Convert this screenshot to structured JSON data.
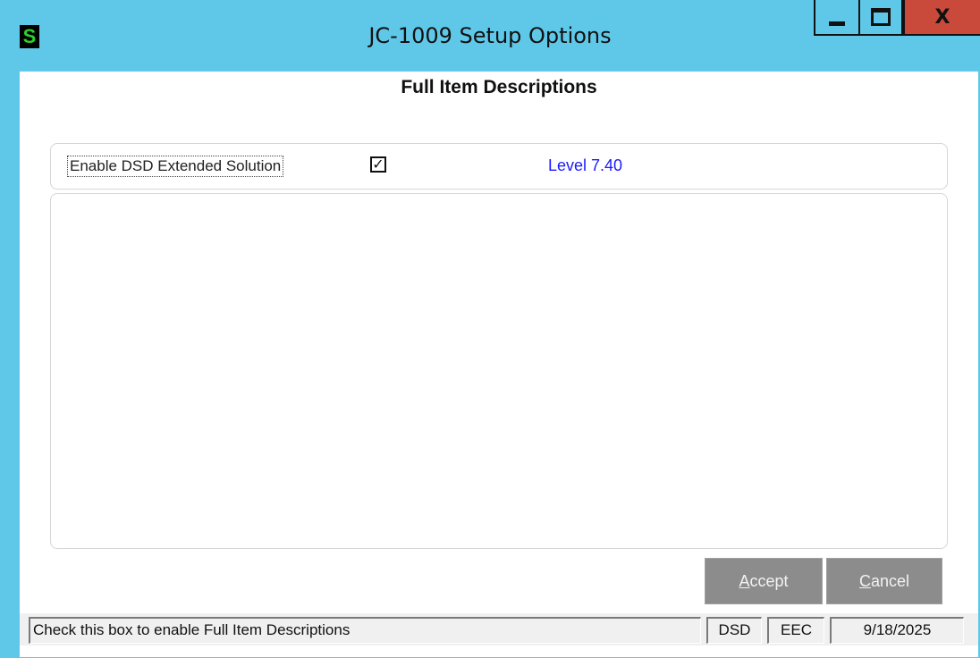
{
  "window": {
    "app_icon_letter": "S",
    "title": "JC-1009  Setup Options",
    "controls": {
      "minimize": "minimize-icon",
      "maximize": "maximize-icon",
      "close": "X"
    },
    "colors": {
      "titlebar": "#5fc8e8",
      "close_button": "#c94a3a"
    }
  },
  "form": {
    "heading": "Full Item Descriptions",
    "enable_label": "Enable DSD Extended Solution",
    "enable_checked": true,
    "check_glyph": "✓",
    "level_text": "Level  7.40",
    "level_color": "#1a1aff"
  },
  "buttons": {
    "accept": {
      "accel": "A",
      "rest": "ccept"
    },
    "cancel": {
      "accel": "C",
      "rest": "ancel"
    }
  },
  "statusbar": {
    "message": "Check this box to enable Full Item Descriptions",
    "module": "DSD",
    "company": "EEC",
    "date": "9/18/2025"
  }
}
